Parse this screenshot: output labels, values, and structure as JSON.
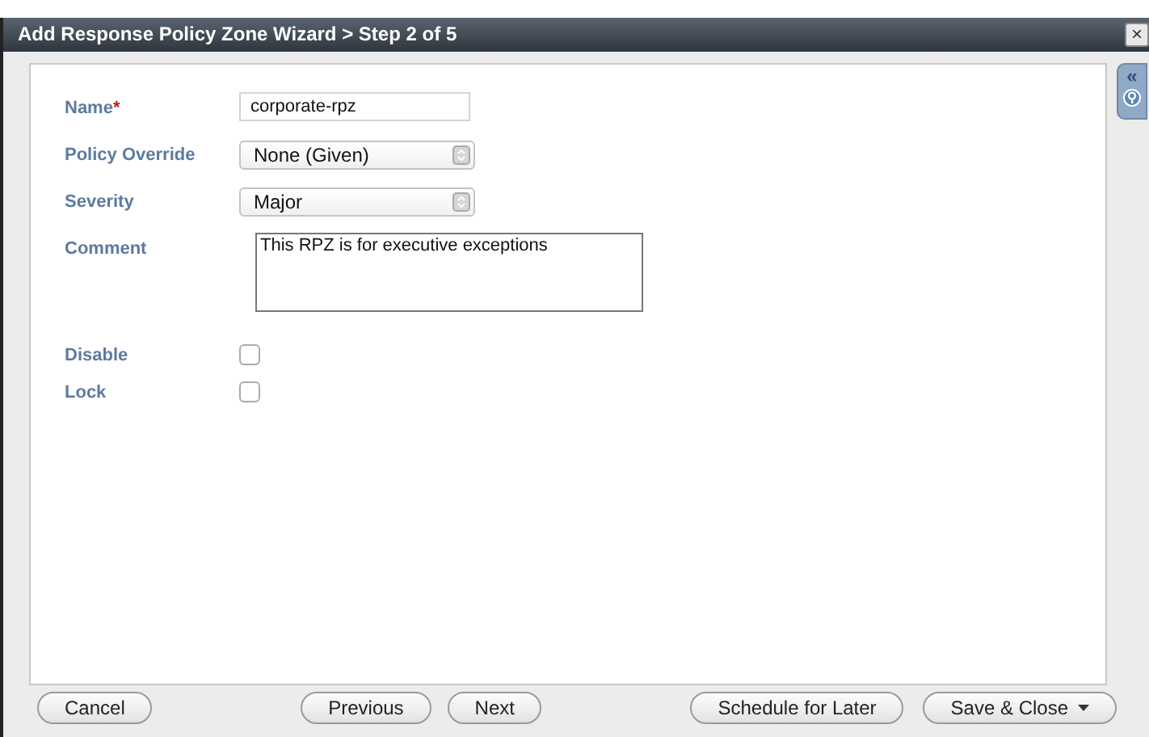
{
  "window": {
    "title": "Add Response Policy Zone Wizard > Step 2 of 5",
    "close": "×"
  },
  "side_tab": {
    "collapse": "«"
  },
  "fields": [
    {
      "kind": "text",
      "label": "Name",
      "required_mark": "*",
      "value": "corporate-rpz"
    },
    {
      "kind": "select",
      "label": "Policy Override",
      "value": "None (Given)"
    },
    {
      "kind": "select",
      "label": "Severity",
      "value": "Major"
    },
    {
      "kind": "textarea",
      "label": "Comment",
      "value": "This RPZ is for executive exceptions"
    },
    {
      "kind": "checkbox",
      "label": "Disable",
      "checked": false
    },
    {
      "kind": "checkbox",
      "label": "Lock",
      "checked": false
    }
  ],
  "footer": {
    "left": [
      {
        "label": "Cancel",
        "dropdown": false
      }
    ],
    "center": [
      {
        "label": "Previous",
        "dropdown": false
      },
      {
        "label": "Next",
        "dropdown": false
      }
    ],
    "right": [
      {
        "label": "Schedule for Later",
        "dropdown": false
      },
      {
        "label": "Save & Close",
        "dropdown": true
      }
    ]
  }
}
